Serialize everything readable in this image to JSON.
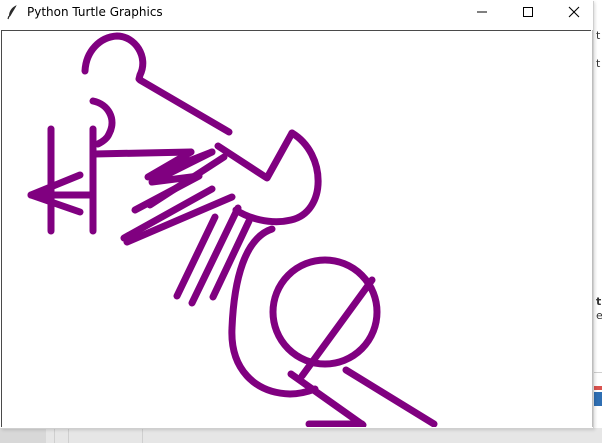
{
  "window": {
    "title": "Python Turtle Graphics",
    "icon": "feather-icon",
    "controls": {
      "minimize_icon": "minimize-icon",
      "maximize_icon": "maximize-icon",
      "close_icon": "close-icon"
    }
  },
  "background_window": {
    "right_fragments": [
      "t",
      "t",
      "t",
      "e"
    ]
  },
  "drawing": {
    "pen_color": "#800080",
    "background_color": "#ffffff"
  }
}
